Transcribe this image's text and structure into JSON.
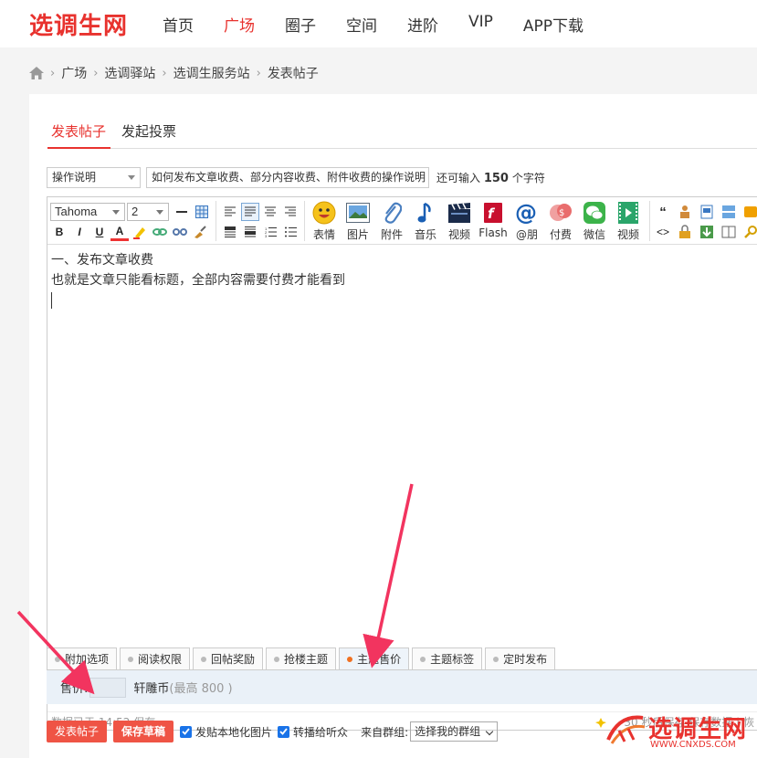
{
  "header": {
    "logo": "选调生网",
    "nav": [
      "首页",
      "广场",
      "圈子",
      "空间",
      "进阶",
      "VIP",
      "APP下载"
    ],
    "active_nav_index": 1
  },
  "breadcrumb": [
    "广场",
    "选调驿站",
    "选调生服务站",
    "发表帖子"
  ],
  "tabs": [
    "发表帖子",
    "发起投票"
  ],
  "subject": {
    "type": "操作说明",
    "title": "如何发布文章收费、部分内容收费、附件收费的操作说明",
    "remain_prefix": "还可输入",
    "remain_count": "150",
    "remain_suffix": "个字符"
  },
  "toolbar": {
    "font": "Tahoma",
    "size": "2",
    "bold": "B",
    "italic": "I",
    "underline": "U",
    "fontcolor": "A",
    "buttons": [
      "表情",
      "图片",
      "附件",
      "音乐",
      "视频",
      "Flash",
      "@朋",
      "付费",
      "微信",
      "视频"
    ]
  },
  "content": {
    "line1": "一、发布文章收费",
    "line2": "也就是文章只能看标题，全部内容需要付费才能看到"
  },
  "status": {
    "left": "数据已于 14:52 保存",
    "right": "30 秒后保存 保存数据 | 恢"
  },
  "options": {
    "tabs": [
      "附加选项",
      "阅读权限",
      "回帖奖励",
      "抢楼主题",
      "主题售价",
      "主题标签",
      "定时发布"
    ],
    "active_index": 4,
    "price_label": "售价:",
    "currency": "轩雕币",
    "max": "(最高 800 )"
  },
  "actions": {
    "post": "发表帖子",
    "draft": "保存草稿",
    "check1": "发贴本地化图片",
    "check2": "转播给听众",
    "group_label": "来自群组:",
    "group_value": "选择我的群组"
  },
  "watermark": {
    "text": "选调生网",
    "url": "WWW.CNXDS.COM"
  },
  "colors": {
    "brand": "#e8322e",
    "button": "#ef5445",
    "arrow": "#f2345f"
  }
}
